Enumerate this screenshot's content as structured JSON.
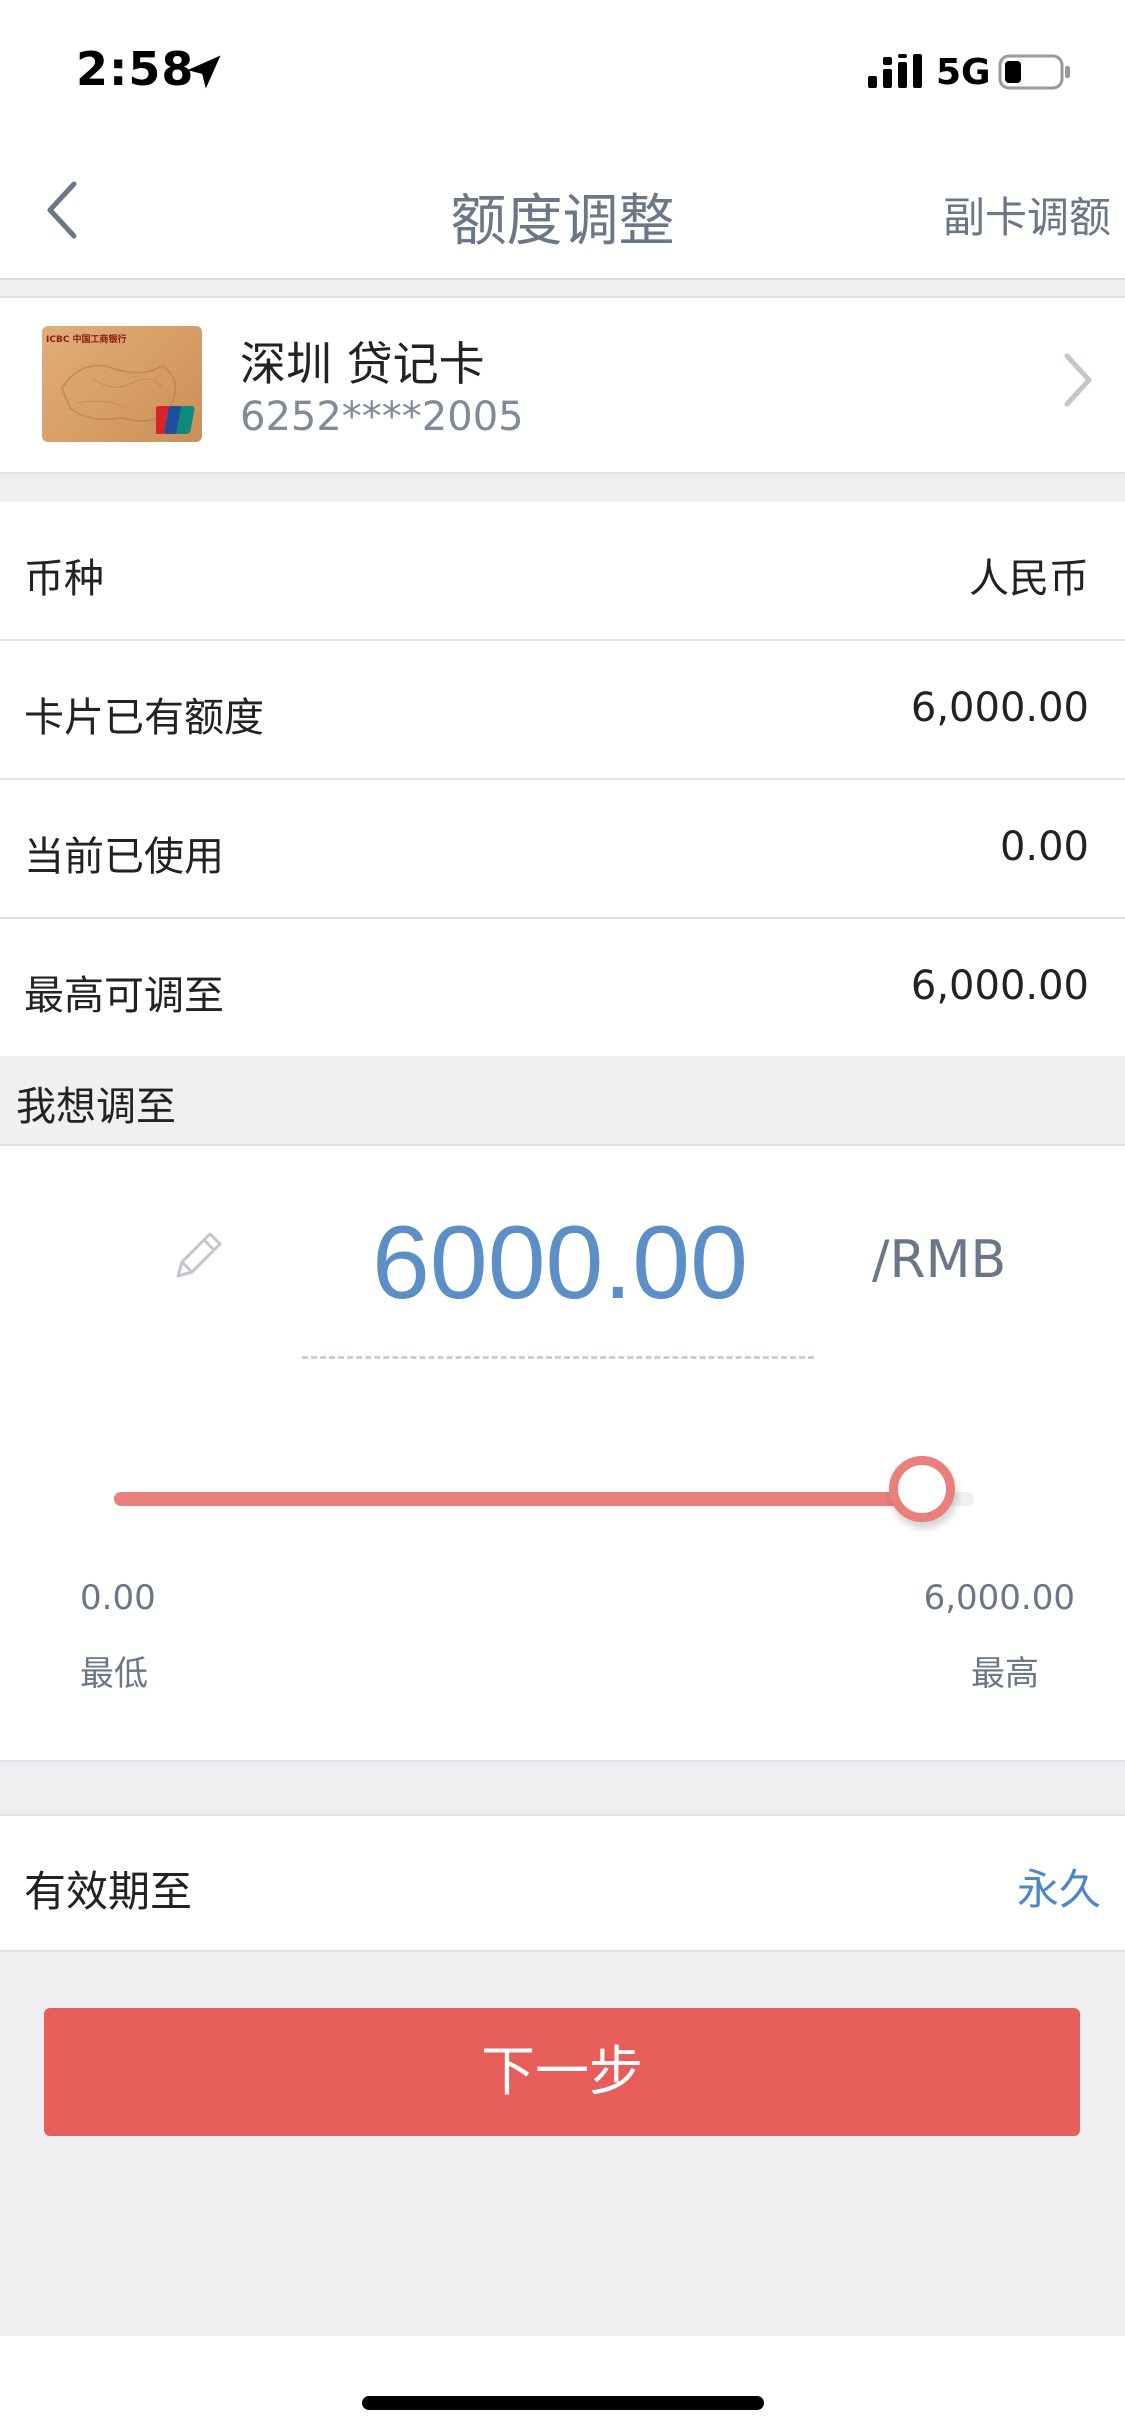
{
  "status_bar": {
    "time": "2:58",
    "network": "5G",
    "battery_level": 0.3
  },
  "nav": {
    "title": "额度调整",
    "right_action": "副卡调额"
  },
  "card": {
    "name": "深圳 贷记卡",
    "number": "6252****2005",
    "bank_mark": "ICBC 中国工商银行"
  },
  "info_rows": [
    {
      "label": "币种",
      "value": "人民币"
    },
    {
      "label": "卡片已有额度",
      "value": "6,000.00"
    },
    {
      "label": "当前已使用",
      "value": "0.00"
    },
    {
      "label": "最高可调至",
      "value": "6,000.00"
    }
  ],
  "adjust": {
    "section_title": "我想调至",
    "amount": "6000.00",
    "unit": "/RMB",
    "slider_fraction": 1.0,
    "min_value": "0.00",
    "min_label": "最低",
    "max_value": "6,000.00",
    "max_label": "最高"
  },
  "validity": {
    "label": "有效期至",
    "value": "永久"
  },
  "next_button": "下一步",
  "colors": {
    "accent_red": "#e65d5a",
    "slider_red": "#ea7f7c",
    "amount_blue": "#5b8fc6",
    "link_blue": "#4f86c6"
  }
}
